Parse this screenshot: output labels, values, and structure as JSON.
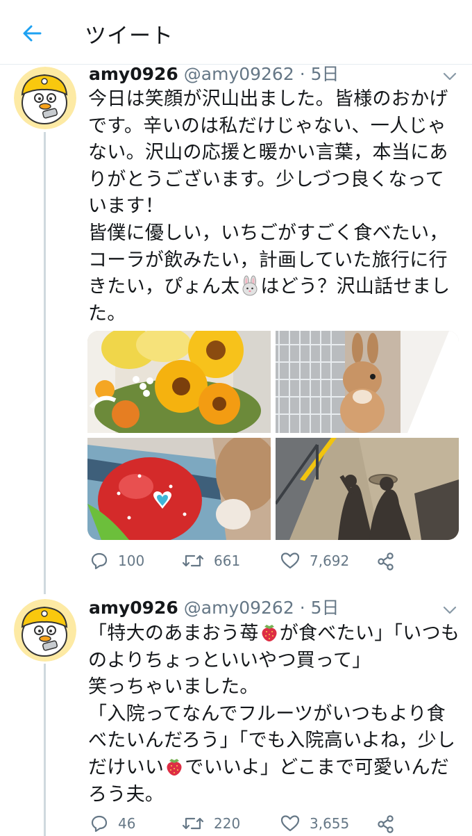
{
  "header": {
    "title": "ツイート"
  },
  "tweets": [
    {
      "name": "amy0926",
      "handle": "@amy09262",
      "dot": "·",
      "time": "5日",
      "text_segments": [
        "今日は笑顔が沢山出ました。皆様のおかげです。辛いのは私だけじゃない、一人じゃない。沢山の応援と暖かい言葉，本当にありがとうございます。少しづつ良くなっています！\n皆僕に優しい，いちごがすごく食べたい，コーラが飲みたい，計画していた旅行に行きたい，ぴょん太",
        "はどう？沢山話せました。"
      ],
      "emoji": [
        "rabbit-emoji"
      ],
      "media": [
        "sunflower-bouquet",
        "rabbit-in-cage",
        "rabbit-with-strawberry-toy",
        "shadows-on-bridge"
      ],
      "replies": "100",
      "retweets": "661",
      "likes": "7,692"
    },
    {
      "name": "amy0926",
      "handle": "@amy09262",
      "dot": "·",
      "time": "5日",
      "text_segments": [
        "「特大のあまおう苺",
        "が食べたい」「いつものよりちょっといいやつ買って」\n笑っちゃいました。\n「入院ってなんでフルーツがいつもより食べたいんだろう」「でも入院高いよね，少しだけいい",
        "でいいよ」どこまで可愛いんだろう夫。"
      ],
      "emoji": [
        "strawberry-emoji",
        "strawberry-emoji"
      ],
      "replies": "46",
      "retweets": "220",
      "likes": "3,655"
    }
  ],
  "colors": {
    "accent": "#1da1f2",
    "text": "#14171a",
    "muted": "#657786",
    "divider": "#e6ecf0"
  }
}
